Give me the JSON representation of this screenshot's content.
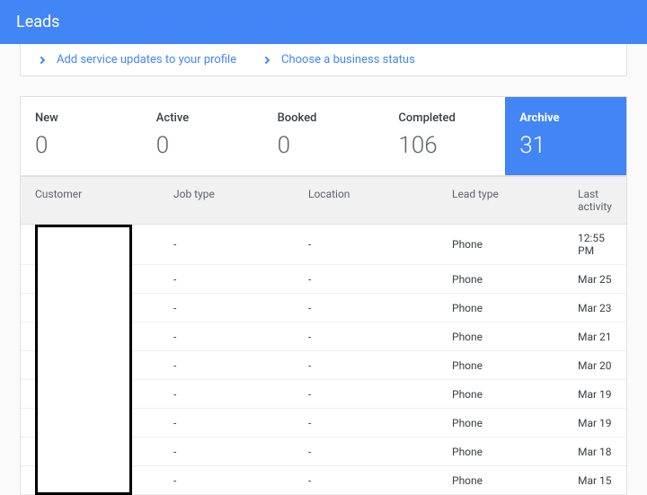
{
  "header": {
    "title": "Leads"
  },
  "notices": [
    {
      "label": "Add service updates to your profile"
    },
    {
      "label": "Choose a business status"
    }
  ],
  "tabs": [
    {
      "key": "new",
      "label": "New",
      "value": "0",
      "active": false
    },
    {
      "key": "active",
      "label": "Active",
      "value": "0",
      "active": false
    },
    {
      "key": "booked",
      "label": "Booked",
      "value": "0",
      "active": false
    },
    {
      "key": "completed",
      "label": "Completed",
      "value": "106",
      "active": false
    },
    {
      "key": "archive",
      "label": "Archive",
      "value": "31",
      "active": true
    }
  ],
  "columns": {
    "customer": "Customer",
    "job": "Job type",
    "loc": "Location",
    "lead": "Lead type",
    "act": "Last activity"
  },
  "rows": [
    {
      "customer": "",
      "job": "-",
      "loc": "-",
      "lead": "Phone",
      "act": "12:55 PM"
    },
    {
      "customer": "",
      "job": "-",
      "loc": "-",
      "lead": "Phone",
      "act": "Mar 25"
    },
    {
      "customer": "",
      "job": "-",
      "loc": "-",
      "lead": "Phone",
      "act": "Mar 23"
    },
    {
      "customer": "",
      "job": "-",
      "loc": "-",
      "lead": "Phone",
      "act": "Mar 21"
    },
    {
      "customer": "",
      "job": "-",
      "loc": "-",
      "lead": "Phone",
      "act": "Mar 20"
    },
    {
      "customer": "",
      "job": "-",
      "loc": "-",
      "lead": "Phone",
      "act": "Mar 19"
    },
    {
      "customer": "",
      "job": "-",
      "loc": "-",
      "lead": "Phone",
      "act": "Mar 19"
    },
    {
      "customer": "",
      "job": "-",
      "loc": "-",
      "lead": "Phone",
      "act": "Mar 18"
    },
    {
      "customer": "",
      "job": "-",
      "loc": "-",
      "lead": "Phone",
      "act": "Mar 15"
    }
  ]
}
